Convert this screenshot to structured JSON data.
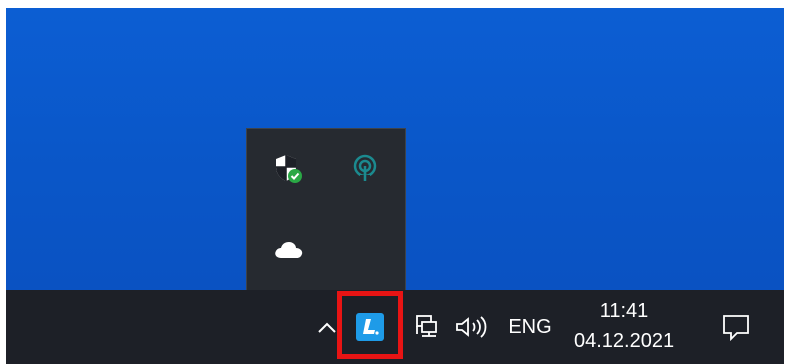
{
  "taskbar": {
    "language": "ENG",
    "clock": {
      "time": "11:41",
      "date": "04.12.2021"
    }
  },
  "tray_overflow": {
    "icons": [
      "windows-security-icon",
      "hotspot-icon",
      "onedrive-icon"
    ]
  },
  "taskbar_icons": [
    "show-hidden-icons-chevron",
    "app-l-icon",
    "network-icon",
    "volume-icon",
    "action-center-icon"
  ],
  "colors": {
    "desktop": "#0a57c9",
    "taskbar": "#1d2027",
    "flyout": "#262a30",
    "highlight": "#e81414",
    "app_icon": "#1e9be8",
    "security_green": "#2aa845",
    "hotspot_teal": "#1b8a8f"
  }
}
